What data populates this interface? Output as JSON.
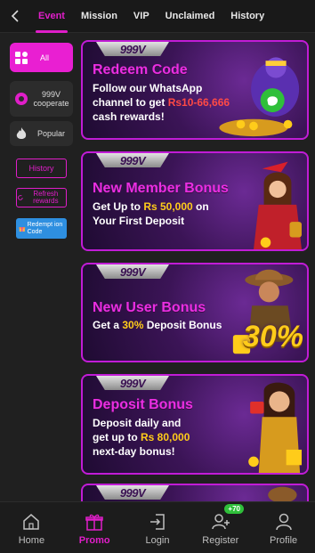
{
  "tabs": [
    {
      "label": "Event",
      "active": true
    },
    {
      "label": "Mission",
      "active": false
    },
    {
      "label": "VIP",
      "active": false
    },
    {
      "label": "Unclaimed",
      "active": false
    },
    {
      "label": "History",
      "active": false
    }
  ],
  "sidebar": {
    "all_label": "All",
    "item_999_label": "999V cooperate",
    "popular_label": "Popular",
    "history_label": "History",
    "refresh_label": "Refresh rewards",
    "redeem_label": "Redempt ion Code"
  },
  "cards": [
    {
      "logo": "999V",
      "title": "Redeem Code",
      "line1": "Follow our WhatsApp",
      "line2_pre": "channel to get ",
      "line2_hl": "Rs10-66,666",
      "line3": "cash rewards!"
    },
    {
      "logo": "999V",
      "title": "New Member Bonus",
      "line1_pre": "Get Up to ",
      "line1_hl": "Rs 50,000",
      "line1_post": " on",
      "line2": "Your First Deposit"
    },
    {
      "logo": "999V",
      "title": "New User Bonus",
      "line1_pre": "Get a ",
      "line1_hl": "30%",
      "line1_post": " Deposit Bonus",
      "badge": "30%"
    },
    {
      "logo": "999V",
      "title": "Deposit Bonus",
      "line1": "Deposit daily and",
      "line2_pre": "get up to ",
      "line2_hl": "Rs 80,000",
      "line3": "next-day bonus!"
    },
    {
      "logo": "999V"
    }
  ],
  "bottom_nav": [
    {
      "label": "Home",
      "icon": "home-icon",
      "active": false
    },
    {
      "label": "Promo",
      "icon": "gift-icon",
      "active": true
    },
    {
      "label": "Login",
      "icon": "login-icon",
      "active": false
    },
    {
      "label": "Register",
      "icon": "register-icon",
      "active": false,
      "badge": "+70"
    },
    {
      "label": "Profile",
      "icon": "profile-icon",
      "active": false
    }
  ],
  "colors": {
    "accent": "#e01ec9",
    "highlight_red": "#ff4a45",
    "highlight_yellow": "#ffcc1a",
    "badge_green": "#2fbf3a"
  }
}
